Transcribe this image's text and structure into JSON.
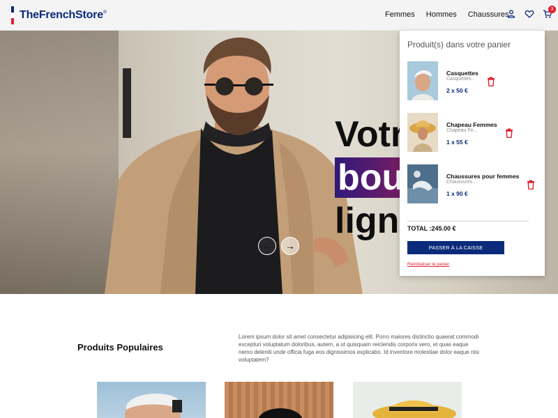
{
  "brand": {
    "name": "TheFrenchStore",
    "mark": "®",
    "flag_colors": [
      "#0a2a7a",
      "#ffffff",
      "#e0202e"
    ]
  },
  "nav": {
    "items": [
      "Femmes",
      "Hommes",
      "Chaussures"
    ]
  },
  "header_icons": [
    "user-icon",
    "heart-icon",
    "cart-icon"
  ],
  "cart_count": "3",
  "hero": {
    "title_line1": "Votr",
    "title_line2": "bout",
    "title_line3": "ligne",
    "prev_label": "←",
    "next_label": "→"
  },
  "section": {
    "title": "Produits Populaires",
    "text": "Lorem ipsum dolor sit amet consectetur adipisicing elit. Porro maiores distinctio quaerat commodi excepturi voluptatum doloribus, autem, a ut quisquam reiciendis corporis vero, et quas eaque nemo deleniti unde officia fuga eos dignissimos explicabo. Id inventore molestiae dolor eaque nisi voluptatem?"
  },
  "cart": {
    "title": "Produit(s) dans votre panier",
    "items": [
      {
        "name": "Casquettes",
        "subtitle": "Casquettes...",
        "price": "2 x 50 €"
      },
      {
        "name": "Chapeau Femmes",
        "subtitle": "Chapeau Fe...",
        "price": "1 x 55 €"
      },
      {
        "name": "Chaussures pour femmes",
        "subtitle": "Chaussures...",
        "price": "1 x 90 €"
      }
    ],
    "total": "TOTAL :245.00 €",
    "checkout_label": "PASSER À LA CAISSE",
    "reset_label": "Réinitialiser le panier"
  },
  "colors": {
    "brand_blue": "#0a2a7a",
    "accent_red": "#e0202e"
  }
}
